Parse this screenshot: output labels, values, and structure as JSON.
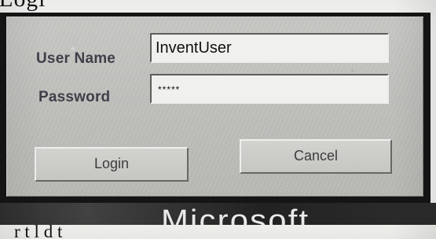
{
  "window": {
    "title_fragment": "Logi"
  },
  "login_form": {
    "username_label": "User Name",
    "username_value": "InventUser",
    "password_label": "Password",
    "password_value": "*****",
    "login_button": "Login",
    "cancel_button": "Cancel"
  },
  "background": {
    "logo_text": "Microsoft",
    "partial_text": "r                                 t  l  d  t"
  },
  "colors": {
    "dialog_frame": "#151515",
    "dialog_face": "#c0c0bc",
    "field_background": "#f0f0ee",
    "label_text": "#3f3f4a"
  }
}
